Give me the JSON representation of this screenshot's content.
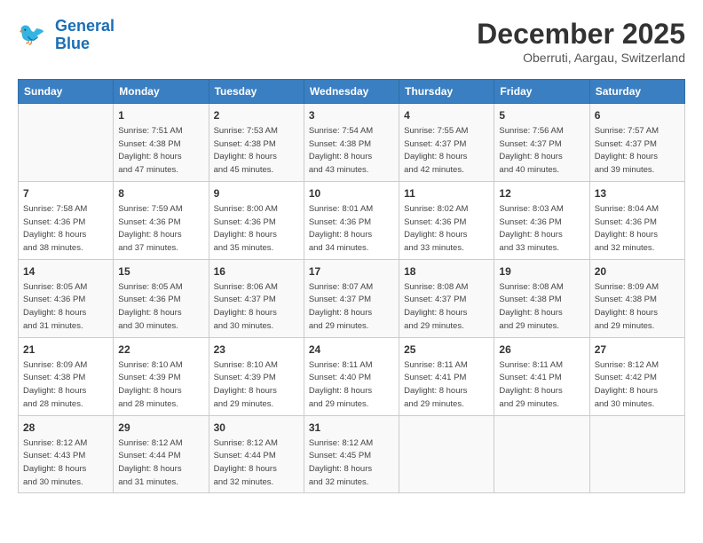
{
  "header": {
    "logo_line1": "General",
    "logo_line2": "Blue",
    "month": "December 2025",
    "location": "Oberruti, Aargau, Switzerland"
  },
  "days_of_week": [
    "Sunday",
    "Monday",
    "Tuesday",
    "Wednesday",
    "Thursday",
    "Friday",
    "Saturday"
  ],
  "weeks": [
    [
      {
        "day": "",
        "content": ""
      },
      {
        "day": "1",
        "content": "Sunrise: 7:51 AM\nSunset: 4:38 PM\nDaylight: 8 hours\nand 47 minutes."
      },
      {
        "day": "2",
        "content": "Sunrise: 7:53 AM\nSunset: 4:38 PM\nDaylight: 8 hours\nand 45 minutes."
      },
      {
        "day": "3",
        "content": "Sunrise: 7:54 AM\nSunset: 4:38 PM\nDaylight: 8 hours\nand 43 minutes."
      },
      {
        "day": "4",
        "content": "Sunrise: 7:55 AM\nSunset: 4:37 PM\nDaylight: 8 hours\nand 42 minutes."
      },
      {
        "day": "5",
        "content": "Sunrise: 7:56 AM\nSunset: 4:37 PM\nDaylight: 8 hours\nand 40 minutes."
      },
      {
        "day": "6",
        "content": "Sunrise: 7:57 AM\nSunset: 4:37 PM\nDaylight: 8 hours\nand 39 minutes."
      }
    ],
    [
      {
        "day": "7",
        "content": "Sunrise: 7:58 AM\nSunset: 4:36 PM\nDaylight: 8 hours\nand 38 minutes."
      },
      {
        "day": "8",
        "content": "Sunrise: 7:59 AM\nSunset: 4:36 PM\nDaylight: 8 hours\nand 37 minutes."
      },
      {
        "day": "9",
        "content": "Sunrise: 8:00 AM\nSunset: 4:36 PM\nDaylight: 8 hours\nand 35 minutes."
      },
      {
        "day": "10",
        "content": "Sunrise: 8:01 AM\nSunset: 4:36 PM\nDaylight: 8 hours\nand 34 minutes."
      },
      {
        "day": "11",
        "content": "Sunrise: 8:02 AM\nSunset: 4:36 PM\nDaylight: 8 hours\nand 33 minutes."
      },
      {
        "day": "12",
        "content": "Sunrise: 8:03 AM\nSunset: 4:36 PM\nDaylight: 8 hours\nand 33 minutes."
      },
      {
        "day": "13",
        "content": "Sunrise: 8:04 AM\nSunset: 4:36 PM\nDaylight: 8 hours\nand 32 minutes."
      }
    ],
    [
      {
        "day": "14",
        "content": "Sunrise: 8:05 AM\nSunset: 4:36 PM\nDaylight: 8 hours\nand 31 minutes."
      },
      {
        "day": "15",
        "content": "Sunrise: 8:05 AM\nSunset: 4:36 PM\nDaylight: 8 hours\nand 30 minutes."
      },
      {
        "day": "16",
        "content": "Sunrise: 8:06 AM\nSunset: 4:37 PM\nDaylight: 8 hours\nand 30 minutes."
      },
      {
        "day": "17",
        "content": "Sunrise: 8:07 AM\nSunset: 4:37 PM\nDaylight: 8 hours\nand 29 minutes."
      },
      {
        "day": "18",
        "content": "Sunrise: 8:08 AM\nSunset: 4:37 PM\nDaylight: 8 hours\nand 29 minutes."
      },
      {
        "day": "19",
        "content": "Sunrise: 8:08 AM\nSunset: 4:38 PM\nDaylight: 8 hours\nand 29 minutes."
      },
      {
        "day": "20",
        "content": "Sunrise: 8:09 AM\nSunset: 4:38 PM\nDaylight: 8 hours\nand 29 minutes."
      }
    ],
    [
      {
        "day": "21",
        "content": "Sunrise: 8:09 AM\nSunset: 4:38 PM\nDaylight: 8 hours\nand 28 minutes."
      },
      {
        "day": "22",
        "content": "Sunrise: 8:10 AM\nSunset: 4:39 PM\nDaylight: 8 hours\nand 28 minutes."
      },
      {
        "day": "23",
        "content": "Sunrise: 8:10 AM\nSunset: 4:39 PM\nDaylight: 8 hours\nand 29 minutes."
      },
      {
        "day": "24",
        "content": "Sunrise: 8:11 AM\nSunset: 4:40 PM\nDaylight: 8 hours\nand 29 minutes."
      },
      {
        "day": "25",
        "content": "Sunrise: 8:11 AM\nSunset: 4:41 PM\nDaylight: 8 hours\nand 29 minutes."
      },
      {
        "day": "26",
        "content": "Sunrise: 8:11 AM\nSunset: 4:41 PM\nDaylight: 8 hours\nand 29 minutes."
      },
      {
        "day": "27",
        "content": "Sunrise: 8:12 AM\nSunset: 4:42 PM\nDaylight: 8 hours\nand 30 minutes."
      }
    ],
    [
      {
        "day": "28",
        "content": "Sunrise: 8:12 AM\nSunset: 4:43 PM\nDaylight: 8 hours\nand 30 minutes."
      },
      {
        "day": "29",
        "content": "Sunrise: 8:12 AM\nSunset: 4:44 PM\nDaylight: 8 hours\nand 31 minutes."
      },
      {
        "day": "30",
        "content": "Sunrise: 8:12 AM\nSunset: 4:44 PM\nDaylight: 8 hours\nand 32 minutes."
      },
      {
        "day": "31",
        "content": "Sunrise: 8:12 AM\nSunset: 4:45 PM\nDaylight: 8 hours\nand 32 minutes."
      },
      {
        "day": "",
        "content": ""
      },
      {
        "day": "",
        "content": ""
      },
      {
        "day": "",
        "content": ""
      }
    ]
  ]
}
